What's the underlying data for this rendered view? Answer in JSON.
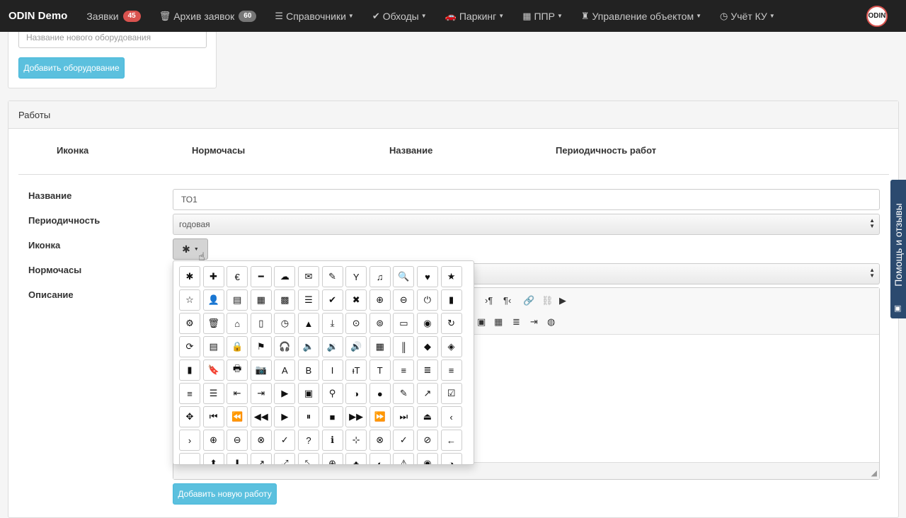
{
  "navbar": {
    "brand": "ODIN Demo",
    "items": [
      {
        "label": "Заявки",
        "icon": "",
        "badge": "45",
        "badge_color": "#d9534f",
        "dropdown": false
      },
      {
        "label": "Архив заявок",
        "icon": "🗑",
        "badge": "60",
        "badge_color": "#777777",
        "dropdown": false
      },
      {
        "label": "Справочники",
        "icon": "☰",
        "dropdown": true
      },
      {
        "label": "Обходы",
        "icon": "✔",
        "dropdown": true
      },
      {
        "label": "Паркинг",
        "icon": "🚗",
        "dropdown": true
      },
      {
        "label": "ППР",
        "icon": "▦",
        "dropdown": true
      },
      {
        "label": "Управление объектом",
        "icon": "♜",
        "dropdown": true
      },
      {
        "label": "Учёт КУ",
        "icon": "◷",
        "dropdown": true
      }
    ],
    "logo_text": "ODIN"
  },
  "equipment": {
    "input_placeholder": "Название нового оборудования",
    "add_button": "Добавить оборудование"
  },
  "works": {
    "panel_title": "Работы",
    "columns": [
      "Иконка",
      "Нормочасы",
      "Название",
      "Периодичность работ"
    ],
    "form": {
      "name_label": "Название",
      "name_value": "ТО1",
      "period_label": "Периодичность",
      "period_value": "годовая",
      "icon_label": "Иконка",
      "icon_selected": "✱",
      "hours_label": "Нормочасы",
      "desc_label": "Описание"
    },
    "add_button": "Добавить новую работу"
  },
  "icon_picker": {
    "icons": [
      "✱",
      "✚",
      "€",
      "━",
      "☁",
      "✉",
      "✎",
      "Y",
      "♫",
      "🔍",
      "♥",
      "★",
      "☆",
      "👤",
      "▤",
      "▦",
      "▩",
      "☰",
      "✔",
      "✖",
      "⊕",
      "⊖",
      "⏻",
      "▮",
      "⚙",
      "🗑",
      "⌂",
      "▯",
      "◷",
      "▲",
      "⤓",
      "⊙",
      "⊚",
      "▭",
      "◉",
      "↻",
      "⟳",
      "▤",
      "🔒",
      "⚑",
      "🎧",
      "🔈",
      "🔉",
      "🔊",
      "▦",
      "║",
      "◆",
      "◈",
      "▮",
      "🔖",
      "🖶",
      "📷",
      "A",
      "B",
      "I",
      "ᵻT",
      "T",
      "≡",
      "≣",
      "≡",
      "≡",
      "☰",
      "⇤",
      "⇥",
      "▶",
      "▣",
      "⚲",
      "◑",
      "●",
      "✎",
      "↗",
      "☑",
      "✥",
      "⏮",
      "⏪",
      "◀◀",
      "▶",
      "⏸",
      "■",
      "▶▶",
      "⏩",
      "⏭",
      "⏏",
      "‹",
      "›",
      "⊕",
      "⊖",
      "⊗",
      "✓",
      "?",
      "ℹ",
      "⊹",
      "⊗",
      "✓",
      "⊘",
      "←",
      "→",
      "⬆",
      "⬇",
      "↗",
      "⤢",
      "⤡",
      "⊕",
      "♣",
      "◐",
      "⚠",
      "◉",
      "◔"
    ]
  },
  "help_tab": {
    "label": "Помощь и отзывы"
  }
}
